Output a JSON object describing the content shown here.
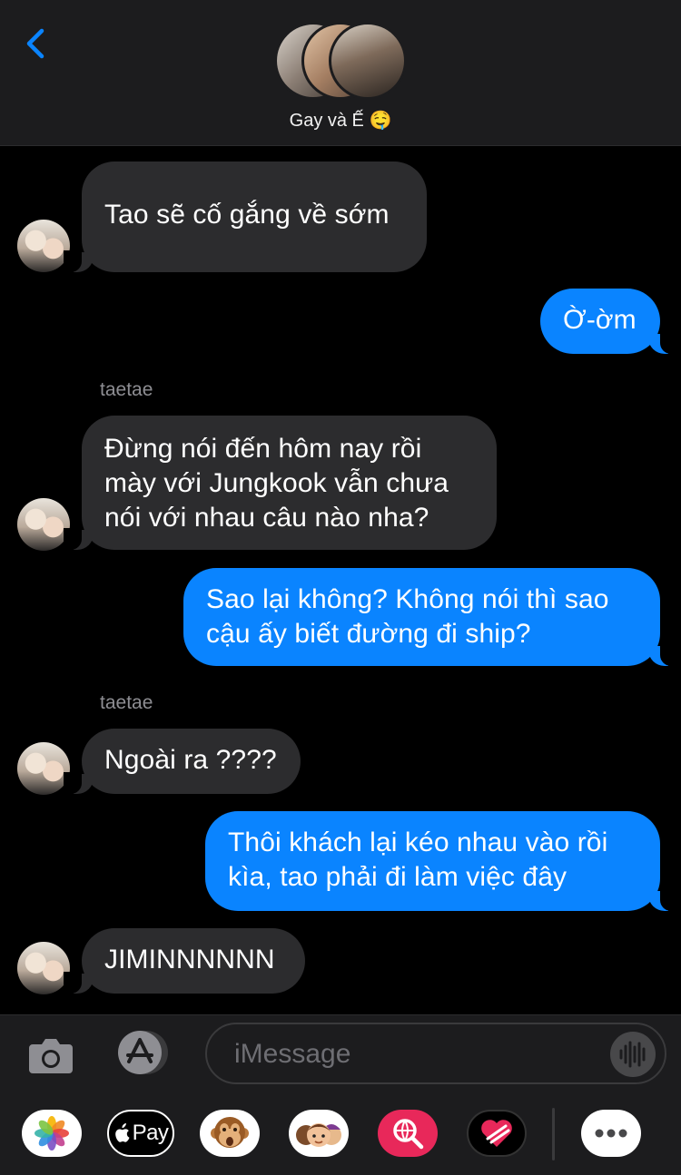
{
  "header": {
    "group_name": "Gay và Ế 🤤"
  },
  "messages": [
    {
      "direction": "in",
      "text": "Tao sẽ cố gắng về sớm"
    },
    {
      "direction": "out",
      "text": "Ờ-ờm"
    },
    {
      "direction": "in",
      "sender": "taetae",
      "lines": [
        "Đừng nói đến hôm nay rồi",
        "mày với Jungkook vẫn chưa",
        "nói với nhau câu nào nha?"
      ]
    },
    {
      "direction": "out",
      "lines": [
        "Sao lại không? Không nói thì sao",
        "cậu ấy biết đường đi ship?"
      ]
    },
    {
      "direction": "in",
      "sender": "taetae",
      "text": "Ngoài ra ????"
    },
    {
      "direction": "out",
      "lines": [
        "Thôi khách lại kéo nhau vào rồi",
        "kìa, tao phải đi làm việc đây"
      ]
    },
    {
      "direction": "in",
      "text": "JIMINNNNNN"
    }
  ],
  "composer": {
    "placeholder": "iMessage"
  },
  "app_strip": {
    "apple_pay_label": "Pay",
    "items": [
      "photos-icon",
      "apple-pay-icon",
      "monkey-emoji-icon",
      "memoji-icon",
      "web-search-icon",
      "digital-touch-icon",
      "more-icon"
    ]
  },
  "colors": {
    "outgoing_bubble": "#0a84ff",
    "incoming_bubble": "#2c2c2e",
    "background": "#000000"
  }
}
